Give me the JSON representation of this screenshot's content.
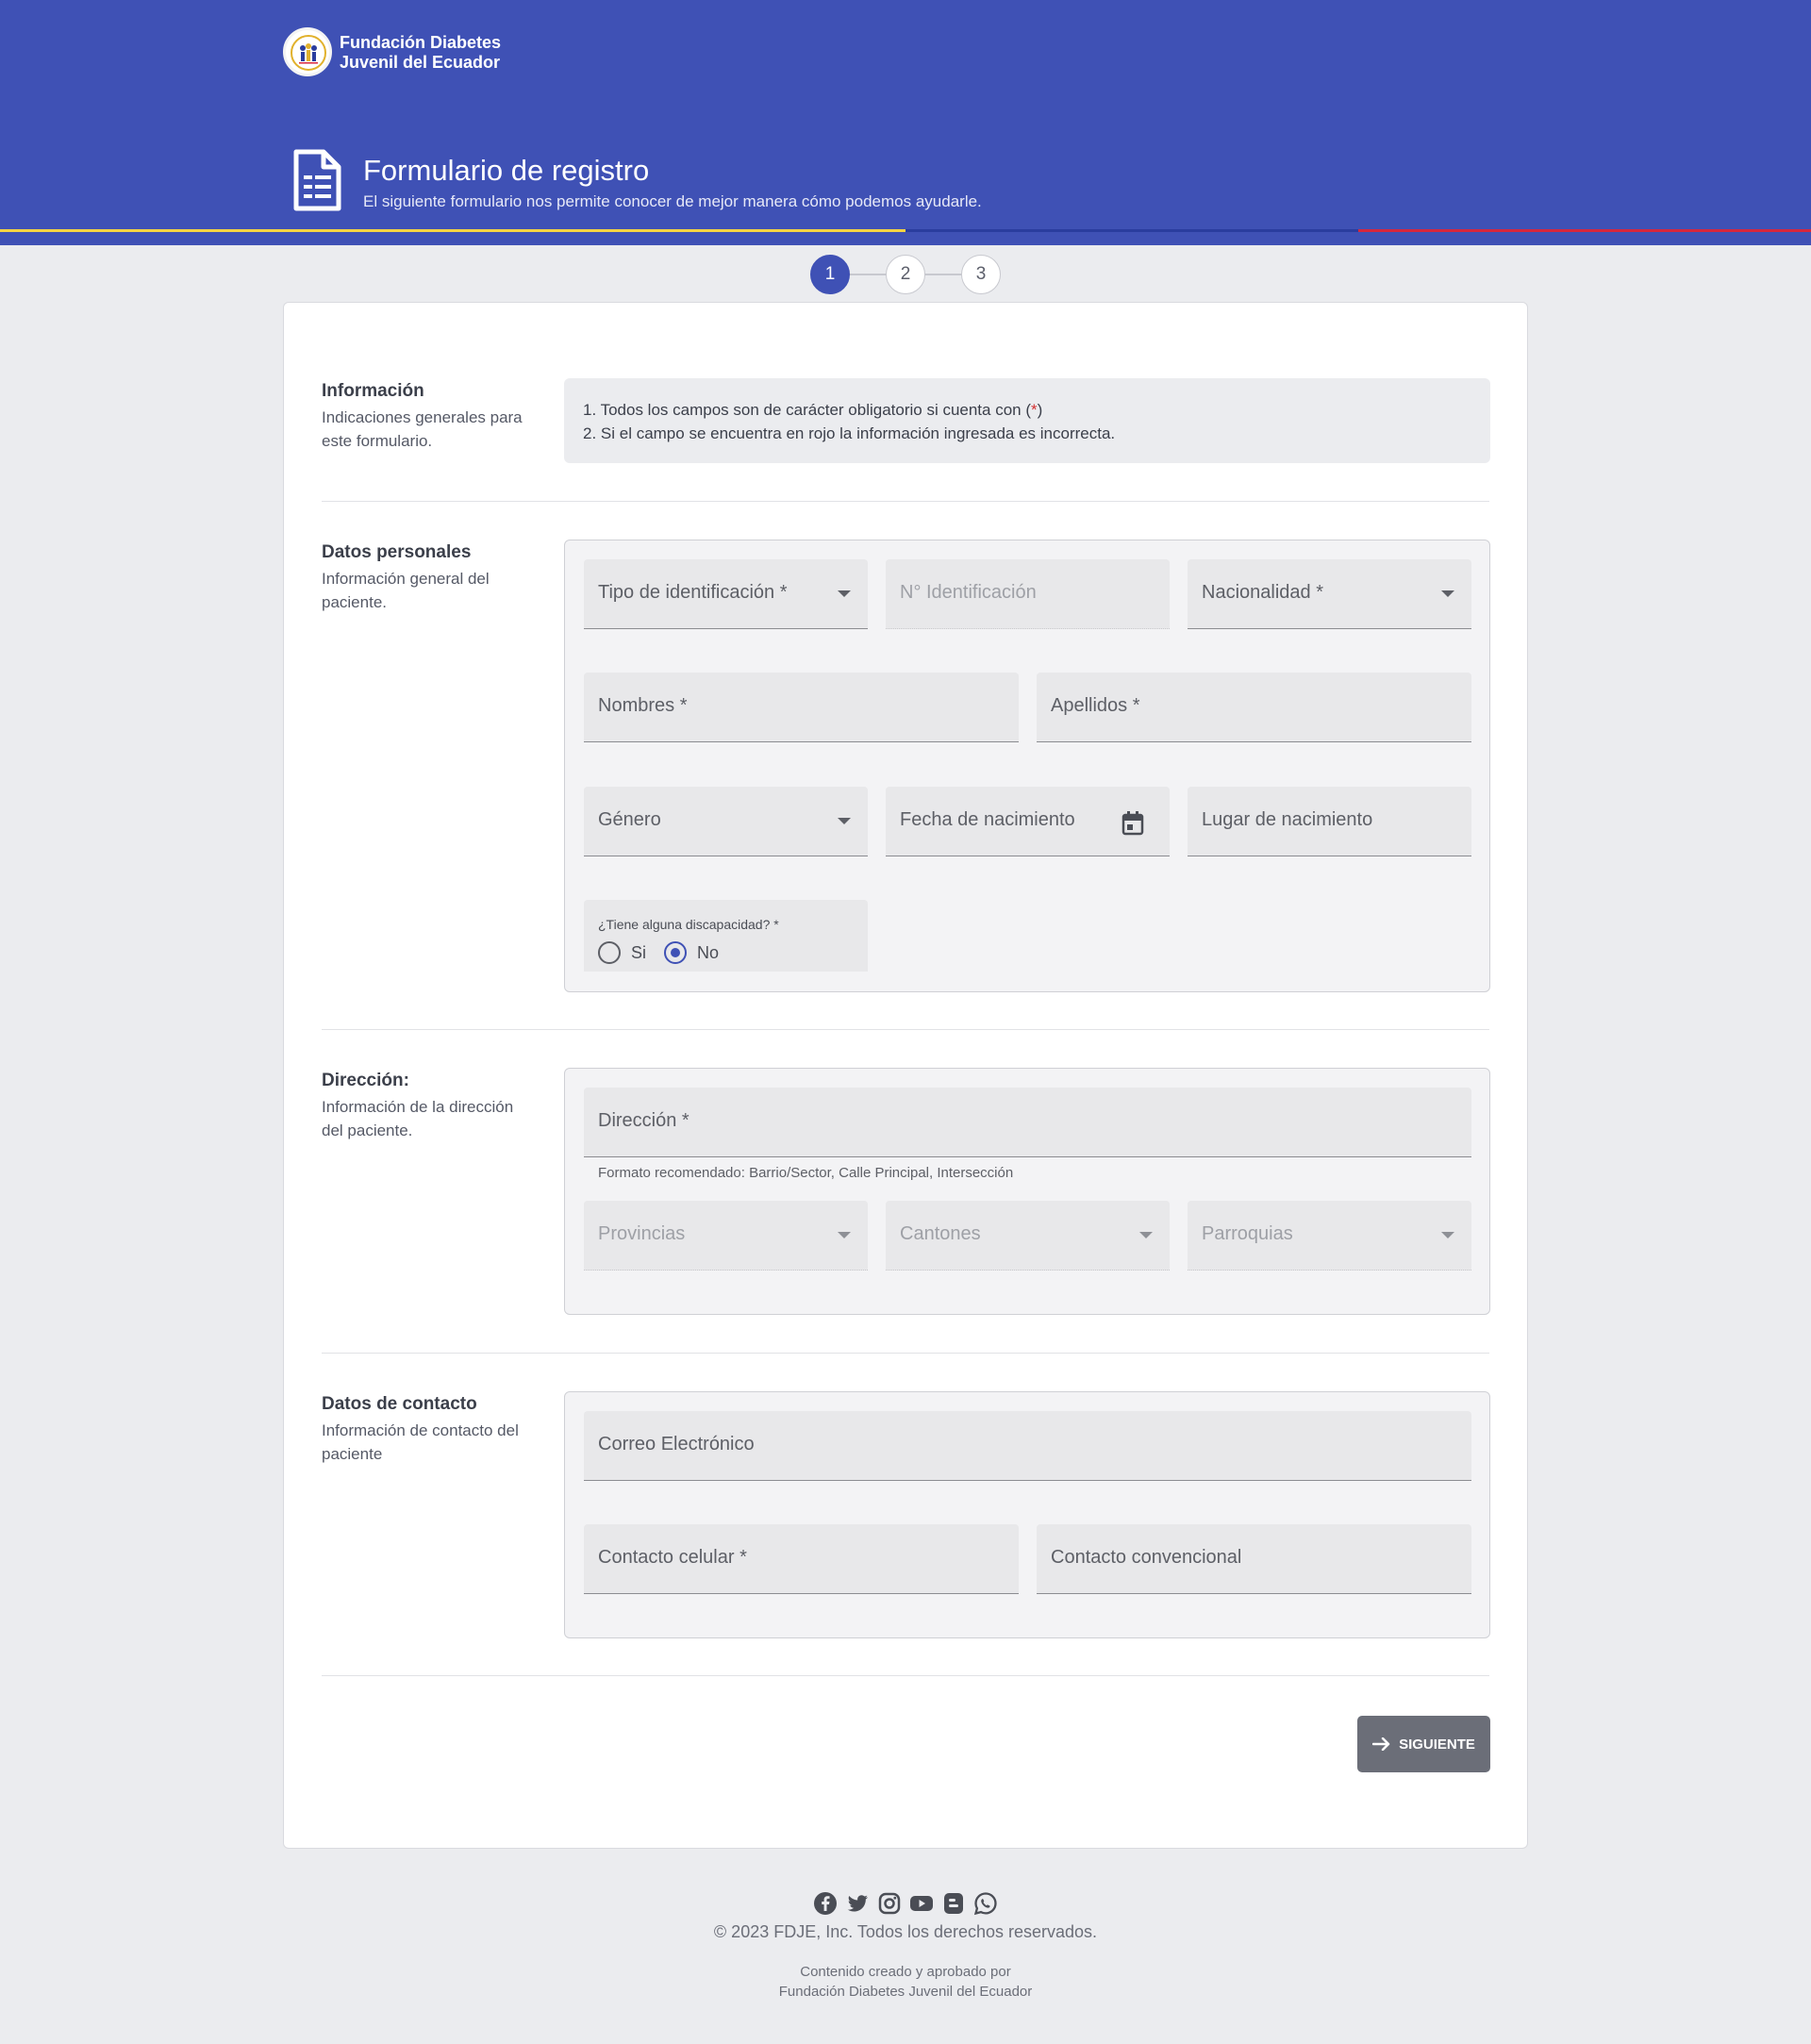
{
  "brand": {
    "name_line1": "Fundación Diabetes",
    "name_line2": "Juvenil del Ecuador"
  },
  "header": {
    "title": "Formulario de registro",
    "subtitle": "El siguiente formulario nos permite conocer de mejor manera cómo podemos ayudarle.",
    "accent_colors": [
      "#f5d442",
      "#2a3d9e",
      "#d7263d"
    ]
  },
  "stepper": {
    "steps": [
      "1",
      "2",
      "3"
    ],
    "active": "1"
  },
  "sections": {
    "info": {
      "title": "Información",
      "desc": "Indicaciones generales para este formulario.",
      "line1_pre": "1. Todos los campos son de carácter obligatorio si cuenta con (",
      "line1_star": "*",
      "line1_post": ")",
      "line2": "2. Si el campo se encuentra en rojo la información ingresada es incorrecta."
    },
    "personal": {
      "title": "Datos personales",
      "desc": "Información general del paciente.",
      "id_type": "Tipo de identificación *",
      "id_number": "N° Identificación",
      "nationality": "Nacionalidad *",
      "first_names": "Nombres *",
      "last_names": "Apellidos *",
      "gender": "Género",
      "birth_date": "Fecha de nacimiento",
      "birth_place": "Lugar de nacimiento",
      "disability_question": "¿Tiene alguna discapacidad? *",
      "option_yes": "Si",
      "option_no": "No",
      "disability_value": "No"
    },
    "address": {
      "title": "Dirección:",
      "desc": "Información de la dirección del paciente.",
      "address_label": "Dirección *",
      "address_hint": "Formato recomendado: Barrio/Sector, Calle Principal, Intersección",
      "province": "Provincias",
      "canton": "Cantones",
      "parish": "Parroquias"
    },
    "contact": {
      "title": "Datos de contacto",
      "desc": "Información de contacto del paciente",
      "email": "Correo Electrónico",
      "mobile": "Contacto celular *",
      "landline": "Contacto convencional"
    }
  },
  "actions": {
    "next_label": "SIGUIENTE"
  },
  "footer": {
    "socials": [
      "facebook-icon",
      "twitter-icon",
      "instagram-icon",
      "youtube-icon",
      "blogger-icon",
      "whatsapp-icon"
    ],
    "copyright": "© 2023 FDJE, Inc. Todos los derechos reservados.",
    "credit_line1": "Contenido creado y aprobado por",
    "credit_line2": "Fundación Diabetes Juvenil del Ecuador"
  }
}
